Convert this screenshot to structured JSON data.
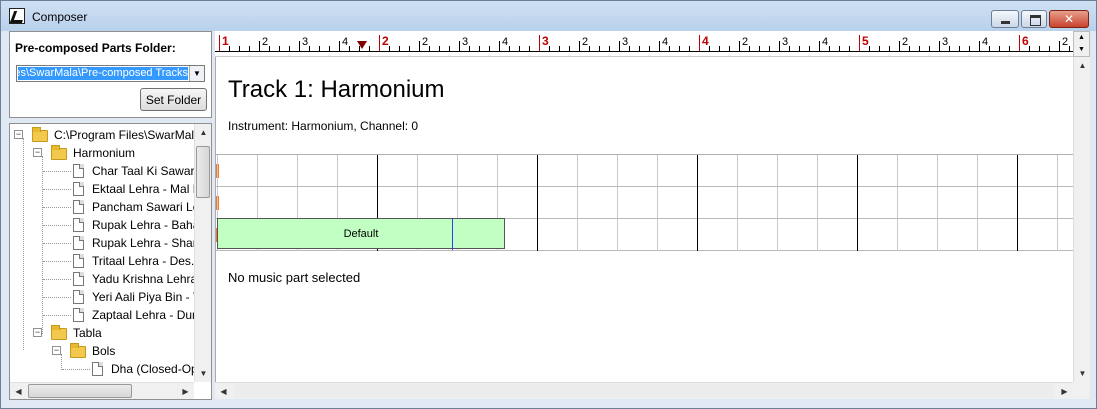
{
  "window": {
    "title": "Composer",
    "icons": [
      "app-icon",
      "minimize-icon",
      "maximize-icon",
      "close-icon"
    ]
  },
  "folder_panel": {
    "label": "Pre-composed Parts Folder:",
    "path_value": "C:\\Program Files\\SwarMala\\Pre-composed Tracks\\",
    "set_folder_label": "Set Folder"
  },
  "tree": {
    "root": "C:\\Program Files\\SwarMala",
    "harmonium": {
      "label": "Harmonium",
      "items": [
        "Char Taal Ki Sawari",
        "Ektaal Lehra - Mal K",
        "Pancham Sawari Le",
        "Rupak Lehra - Baha",
        "Rupak Lehra - Shan",
        "Tritaal Lehra - Des.s",
        "Yadu Krishna Lehra",
        "Yeri Aali Piya Bin - Y",
        "Zaptaal Lehra - Dur"
      ]
    },
    "tabla": {
      "label": "Tabla",
      "bols": {
        "label": "Bols",
        "items": [
          "Dha (Closed-Op"
        ]
      }
    }
  },
  "ruler": {
    "labels": [
      "1",
      "2",
      "3",
      "4",
      "2",
      "2",
      "3",
      "4",
      "3",
      "2",
      "3",
      "4",
      "4",
      "2",
      "3",
      "4",
      "5",
      "2",
      "3",
      "4",
      "6",
      "2"
    ]
  },
  "track": {
    "title": "Track 1: Harmonium",
    "instrument": "Instrument: Harmonium, Channel: 0",
    "part_label": "Default",
    "status": "No music part selected"
  }
}
